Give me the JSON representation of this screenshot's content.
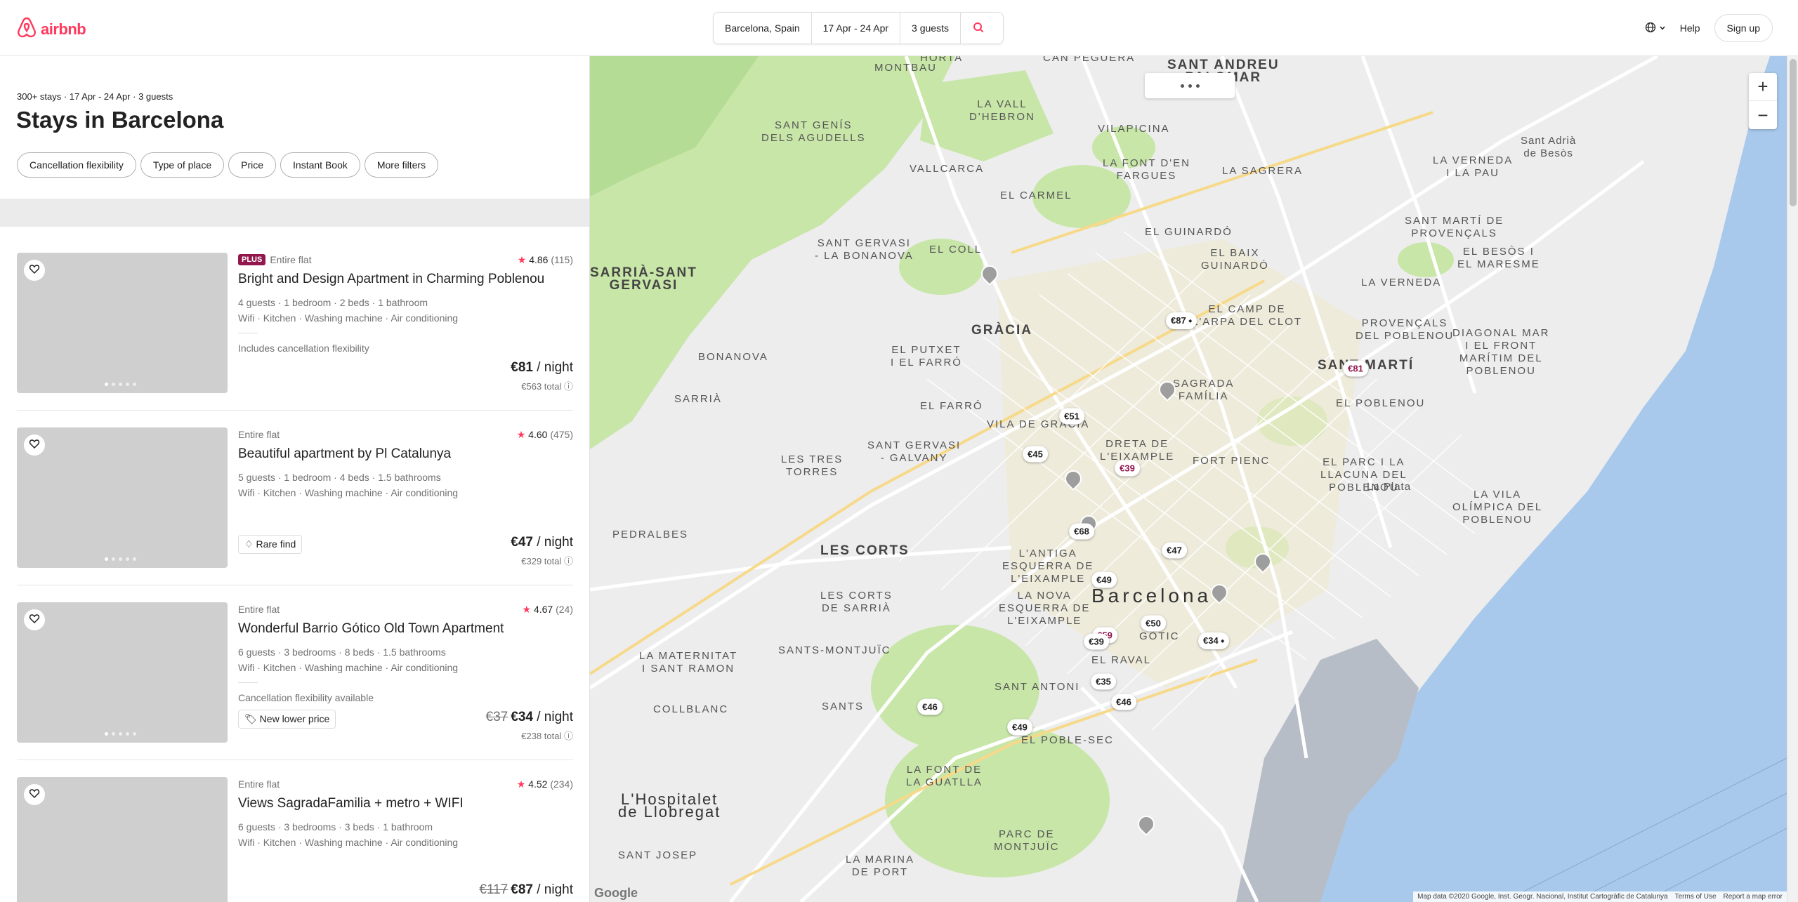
{
  "header": {
    "logo_text": "airbnb",
    "search": {
      "location": "Barcelona, Spain",
      "dates": "17 Apr - 24 Apr",
      "guests": "3 guests"
    },
    "help_label": "Help",
    "signup_label": "Sign up",
    "icons": {
      "logo": "airbnb-logo-icon",
      "search": "search-icon",
      "globe": "globe-icon",
      "chevron": "chevron-down-icon"
    }
  },
  "results": {
    "summary": "300+ stays · 17 Apr - 24 Apr · 3 guests",
    "title": "Stays in Barcelona",
    "filters": [
      "Cancellation flexibility",
      "Type of place",
      "Price",
      "Instant Book",
      "More filters"
    ]
  },
  "listings": [
    {
      "plus_badge": "PLUS",
      "type": "Entire flat",
      "rating": "4.86",
      "reviews": "(115)",
      "name": "Bright and Design Apartment in Charming Poblenou",
      "details": "4 guests · 1 bedroom · 2 beds · 1 bathroom",
      "amenities": "Wifi · Kitchen · Washing machine · Air conditioning",
      "note": "Includes cancellation flexibility",
      "badge": "",
      "old_price": "",
      "price": "€81",
      "per_night": " / night",
      "total": "€563 total"
    },
    {
      "plus_badge": "",
      "type": "Entire flat",
      "rating": "4.60",
      "reviews": "(475)",
      "name": "Beautiful apartment by Pl Catalunya",
      "details": "5 guests · 1 bedroom · 4 beds · 1.5 bathrooms",
      "amenities": "Wifi · Kitchen · Washing machine · Air conditioning",
      "note": "",
      "badge": "Rare find",
      "old_price": "",
      "price": "€47",
      "per_night": " / night",
      "total": "€329 total"
    },
    {
      "plus_badge": "",
      "type": "Entire flat",
      "rating": "4.67",
      "reviews": "(24)",
      "name": "Wonderful Barrio Gótico Old Town Apartment",
      "details": "6 guests · 3 bedrooms · 8 beds · 1.5 bathrooms",
      "amenities": "Wifi · Kitchen · Washing machine · Air conditioning",
      "note": "Cancellation flexibility available",
      "badge": "New lower price",
      "old_price": "€37",
      "price": "€34",
      "per_night": " / night",
      "total": "€238 total"
    },
    {
      "plus_badge": "",
      "type": "Entire flat",
      "rating": "4.52",
      "reviews": "(234)",
      "name": "Views SagradaFamilia + metro + WIFI",
      "details": "6 guests · 3 bedrooms · 3 beds · 1 bathroom",
      "amenities": "Wifi · Kitchen · Washing machine · Air conditioning",
      "note": "",
      "badge": "",
      "old_price": "€117",
      "price": "€87",
      "per_night": " / night",
      "total": ""
    }
  ],
  "map": {
    "price_pins": [
      {
        "label": "€87",
        "tag": true
      },
      {
        "label": "€81",
        "selected": true
      },
      {
        "label": "€51"
      },
      {
        "label": "€45"
      },
      {
        "label": "€39",
        "selected": true
      },
      {
        "label": "€68"
      },
      {
        "label": "€47"
      },
      {
        "label": "€49"
      },
      {
        "label": "€50"
      },
      {
        "label": "€59",
        "selected": true
      },
      {
        "label": "€39"
      },
      {
        "label": "€34",
        "tag": true
      },
      {
        "label": "€35"
      },
      {
        "label": "€46"
      },
      {
        "label": "€46"
      },
      {
        "label": "€49"
      }
    ],
    "labels": [
      "HORTA",
      "CAN PEGUERA",
      "SANT ANDREU\nPALOMAR",
      "MONTBAU",
      "LA VALL\nD'HEBRON",
      "VILAPICINA",
      "SANT GENÍS\nDELS AGUDELLS",
      "LA FONT D'EN\nFARGUES",
      "LA SAGRERA",
      "EL CARMEL",
      "LA VERNEDA\nI LA PAU",
      "EL GUINARDÓ",
      "EL COLL",
      "EL BAIX\nGUINARDÓ",
      "SANT MARTÍ DE\nPROVENÇALS",
      "EL BESÒS I\nEL MARESME",
      "SANT GERVASI\n- LA BONANOVA",
      "LA VERNEDA",
      "GRÀCIA",
      "EL CAMP DE\nL'ARPA DEL CLOT",
      "PROVENÇALS\nDEL POBLENOU",
      "DIAGONAL MAR\nI EL FRONT\nMARÍTIM DEL\nPOBLENOU",
      "BONANOVA",
      "EL PUTXET\nI EL FARRÓ",
      "SANT MARTÍ",
      "SARRIÀ",
      "SAGRADA\nFAMÍLIA",
      "EL POBLENOU",
      "EL FARRÓ",
      "VILA DE GRÀCIA",
      "DRETA DE\nL'EIXAMPLE",
      "FORT PIENC",
      "SANT GERVASI\n- GALVANY",
      "LES TRES\nTORRES",
      "EL PARC I LA\nLLACUNA DEL\nPOBLENOU",
      "LA VILA\nOLÍMPICA DEL\nPOBLENOU",
      "PEDRALBES",
      "LES CORTS",
      "L'ANTIGA\nESQUERRA DE\nL'EIXAMPLE",
      "LA NOVA\nESQUERRA DE\nL'EIXAMPLE",
      "Barcelona",
      "LES CORTS\nDE SARRIÀ",
      "SANTS-MONTJUÏC",
      "LA MATERNITAT\nI SANT RAMON",
      "SANT ANTONI",
      "EL RAVAL",
      "GÒTIC",
      "COLLBLANC",
      "SANTS",
      "EL POBLE-SEC",
      "LA FONT DE\nLA GUATLLA",
      "L'Hospitalet\nde Llobregat",
      "PARC DE\nMONTJUÏC",
      "SANT JOSEP",
      "LA MARINA\nDE PORT",
      "Sant Adrià\nde Besòs",
      "La Plata",
      "VALLCARCA",
      "SARRIÀ-SANT\nGERVASI"
    ],
    "zoom_in": "+",
    "zoom_out": "−",
    "google_logo": "Google",
    "attribution": "Map data ©2020 Google, Inst. Geogr. Nacional, Institut Cartogràfic de Catalunya",
    "terms": "Terms of Use",
    "report": "Report a map error",
    "colors": {
      "land": "#ececec",
      "park": "#c8e6a8",
      "water": "#a9c9ec",
      "road": "#ffffff",
      "brand": "#ff385c",
      "selected_pin": "#92174d"
    }
  }
}
